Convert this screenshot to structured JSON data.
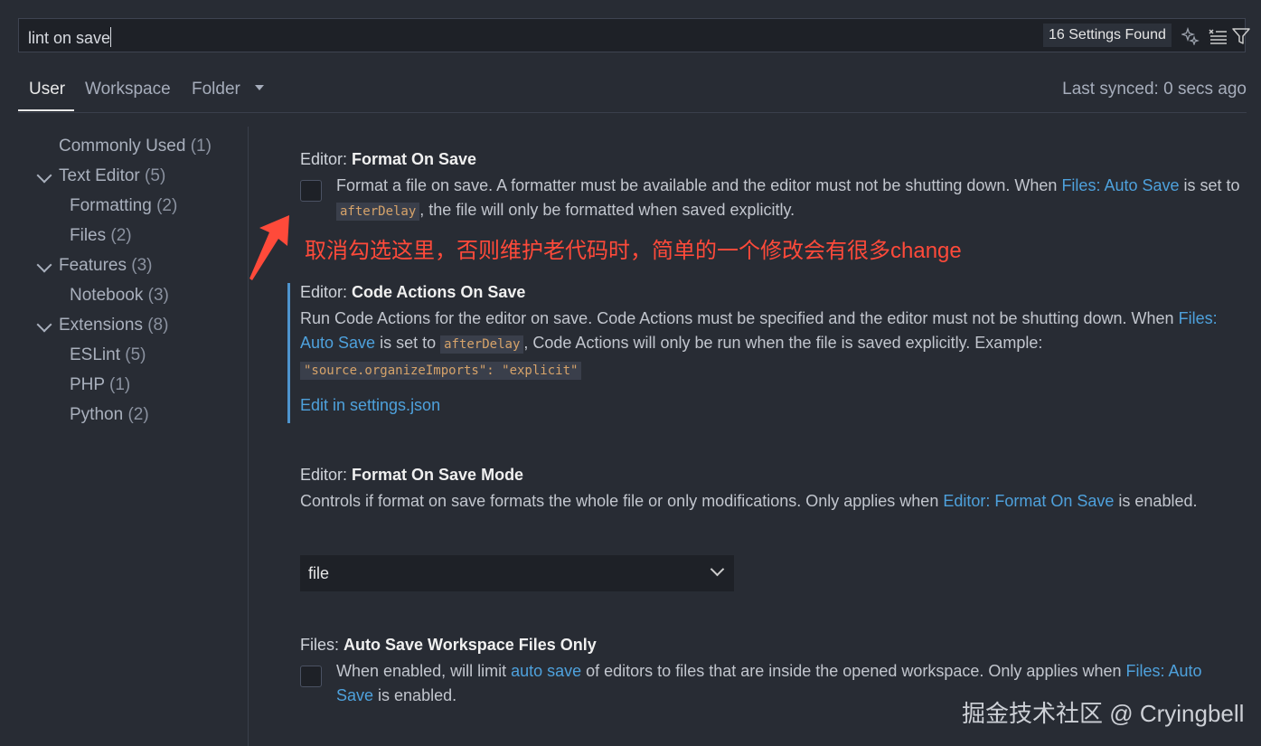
{
  "search": {
    "value": "lint on save",
    "results_badge": "16 Settings Found"
  },
  "tabs": [
    {
      "label": "User"
    },
    {
      "label": "Workspace"
    },
    {
      "label": "Folder"
    }
  ],
  "sync_status": "Last synced: 0 secs ago",
  "sidebar": {
    "items": [
      {
        "label": "Commonly Used",
        "count": "(1)"
      },
      {
        "label": "Text Editor",
        "count": "(5)"
      },
      {
        "label": "Formatting",
        "count": "(2)"
      },
      {
        "label": "Files",
        "count": "(2)"
      },
      {
        "label": "Features",
        "count": "(3)"
      },
      {
        "label": "Notebook",
        "count": "(3)"
      },
      {
        "label": "Extensions",
        "count": "(8)"
      },
      {
        "label": "ESLint",
        "count": "(5)"
      },
      {
        "label": "PHP",
        "count": "(1)"
      },
      {
        "label": "Python",
        "count": "(2)"
      }
    ]
  },
  "settings": [
    {
      "category": "Editor: ",
      "name": "Format On Save",
      "checked": false,
      "desc_1": "Format a file on save. A formatter must be available and the editor must not be shutting down. When ",
      "desc_link": "Files: Auto Save",
      "desc_2": " is set to ",
      "desc_code": "afterDelay",
      "desc_3": ", the file will only be formatted when saved explicitly."
    },
    {
      "category": "Editor: ",
      "name": "Code Actions On Save",
      "desc_1": "Run Code Actions for the editor on save. Code Actions must be specified and the editor must not be shutting down. When ",
      "desc_link": "Files: Auto Save",
      "desc_2": " is set to ",
      "desc_code": "afterDelay",
      "desc_3": ", Code Actions will only be run when the file is saved explicitly. Example: ",
      "desc_example": "\"source.organizeImports\": \"explicit\"",
      "edit_link": "Edit in settings.json"
    },
    {
      "category": "Editor: ",
      "name": "Format On Save Mode",
      "desc_1": "Controls if format on save formats the whole file or only modifications. Only applies when ",
      "desc_link": "Editor: Format On Save",
      "desc_2": " is enabled.",
      "select_value": "file"
    },
    {
      "category": "Files: ",
      "name": "Auto Save Workspace Files Only",
      "checked": false,
      "desc_1": "When enabled, will limit ",
      "desc_link": "auto save",
      "desc_2": " of editors to files that are inside the opened workspace. Only applies when ",
      "desc_link2": "Files: Auto Save",
      "desc_3": " is enabled."
    }
  ],
  "annotation": {
    "text": "取消勾选这里，否则维护老代码时，简单的一个修改会有很多change",
    "color": "#ff4a3a"
  },
  "watermark": "掘金技术社区 @ Cryingbell",
  "colors": {
    "background": "#282c34",
    "link": "#4ea1dc",
    "focus_bar": "#4e94ce",
    "code_text": "#d6a36a"
  }
}
